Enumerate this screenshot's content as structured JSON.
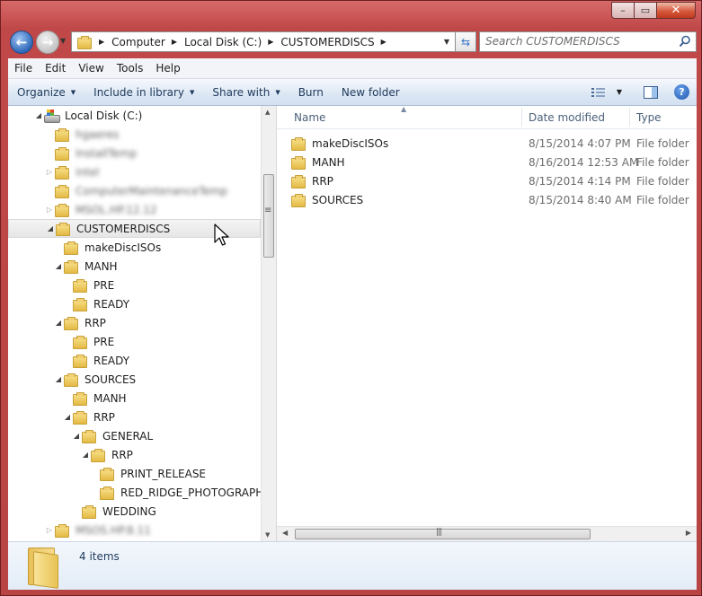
{
  "window": {
    "caption": {
      "minimize": "–",
      "maximize": "▭",
      "close": "✕"
    }
  },
  "address": {
    "segments": [
      "Computer",
      "Local Disk (C:)",
      "CUSTOMERDISCS"
    ]
  },
  "search": {
    "placeholder": "Search CUSTOMERDISCS"
  },
  "menu": {
    "file": "File",
    "edit": "Edit",
    "view": "View",
    "tools": "Tools",
    "help": "Help"
  },
  "commands": {
    "organize": "Organize",
    "include_in_library": "Include in library",
    "share_with": "Share with",
    "burn": "Burn",
    "new_folder": "New folder"
  },
  "nav_tree": {
    "local_disk": "Local Disk (C:)",
    "blurred": [
      "hgaeres",
      "InstallTemp",
      "intel",
      "ComputerMaintenanceTemp",
      "MSOL.HP.12.12",
      "MSOS.HP.8.11"
    ],
    "customerdiscs": "CUSTOMERDISCS",
    "makediscisos": "makeDiscISOs",
    "manh": "MANH",
    "manh_pre": "PRE",
    "manh_ready": "READY",
    "rrp": "RRP",
    "rrp_pre": "PRE",
    "rrp_ready": "READY",
    "sources": "SOURCES",
    "sources_manh": "MANH",
    "sources_rrp": "RRP",
    "general": "GENERAL",
    "general_rrp": "RRP",
    "print_release": "PRINT_RELEASE",
    "red_ridge_photography": "RED_RIDGE_PHOTOGRAPHY",
    "wedding": "WEDDING"
  },
  "columns": {
    "name": "Name",
    "date_modified": "Date modified",
    "type": "Type"
  },
  "files": [
    {
      "name": "makeDiscISOs",
      "date": "8/15/2014 4:07 PM",
      "type": "File folder"
    },
    {
      "name": "MANH",
      "date": "8/16/2014 12:53 AM",
      "type": "File folder"
    },
    {
      "name": "RRP",
      "date": "8/15/2014 4:14 PM",
      "type": "File folder"
    },
    {
      "name": "SOURCES",
      "date": "8/15/2014 8:40 AM",
      "type": "File folder"
    }
  ],
  "details": {
    "item_count": "4 items"
  }
}
